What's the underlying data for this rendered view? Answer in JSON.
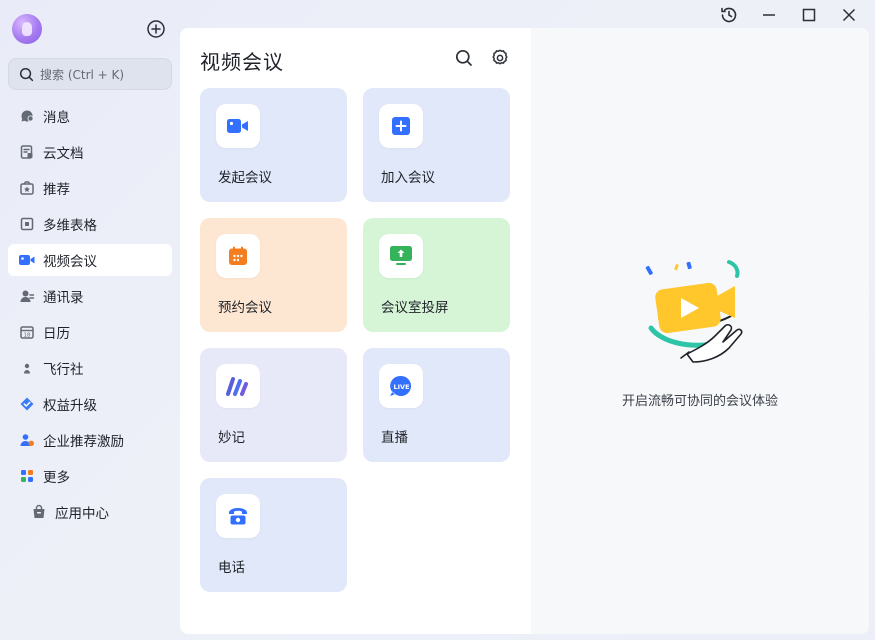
{
  "window_controls": {
    "history_icon": "history-icon",
    "minimize_icon": "minimize-icon",
    "maximize_icon": "maximize-icon",
    "close_icon": "close-icon"
  },
  "sidebar": {
    "avatar_icon": "user-avatar",
    "add_icon": "plus-circle-icon",
    "search": {
      "placeholder": "搜索 (Ctrl + K)"
    },
    "items": [
      {
        "label": "消息",
        "icon": "message-icon"
      },
      {
        "label": "云文档",
        "icon": "cloud-doc-icon"
      },
      {
        "label": "推荐",
        "icon": "recommend-icon"
      },
      {
        "label": "多维表格",
        "icon": "table-icon"
      },
      {
        "label": "视频会议",
        "icon": "video-meeting-icon",
        "active": true
      },
      {
        "label": "通讯录",
        "icon": "contacts-icon"
      },
      {
        "label": "日历",
        "icon": "calendar-icon"
      },
      {
        "label": "飞行社",
        "icon": "flight-club-icon"
      },
      {
        "label": "权益升级",
        "icon": "upgrade-icon"
      },
      {
        "label": "企业推荐激励",
        "icon": "referral-icon"
      },
      {
        "label": "更多",
        "icon": "more-icon"
      },
      {
        "label": "应用中心",
        "icon": "app-center-icon"
      }
    ]
  },
  "main": {
    "title": "视频会议",
    "search_icon": "search-icon",
    "settings_icon": "gear-icon",
    "cards": [
      {
        "label": "发起会议",
        "icon": "camera-icon",
        "bg": "#e1e8f9",
        "color": "#3370ff"
      },
      {
        "label": "加入会议",
        "icon": "plus-square-icon",
        "bg": "#e1e8f9",
        "color": "#3370ff"
      },
      {
        "label": "预约会议",
        "icon": "calendar-schedule-icon",
        "bg": "#fde6d2",
        "color": "#f57c1f"
      },
      {
        "label": "会议室投屏",
        "icon": "screen-share-icon",
        "bg": "#d6f5d6",
        "color": "#34b35a"
      },
      {
        "label": "妙记",
        "icon": "minutes-icon",
        "bg": "#e8e9f8",
        "color": "#5a5fd8"
      },
      {
        "label": "直播",
        "icon": "live-icon",
        "bg": "#e1e8f9",
        "color": "#3370ff"
      },
      {
        "label": "电话",
        "icon": "phone-icon",
        "bg": "#e1e8f9",
        "color": "#3370ff"
      }
    ]
  },
  "right": {
    "illustration": "video-meeting-illustration",
    "text": "开启流畅可协同的会议体验"
  },
  "live_badge": "LIVE"
}
